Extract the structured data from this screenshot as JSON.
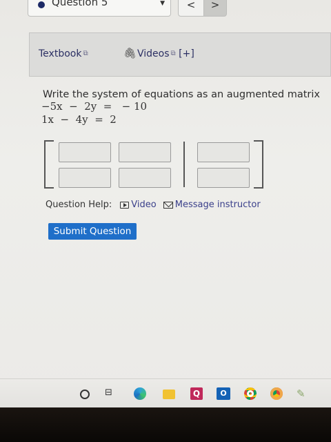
{
  "nav": {
    "question_label": "Question 5",
    "prev_symbol": "<",
    "next_symbol": ">"
  },
  "resources": {
    "textbook_label": "Textbook",
    "videos_label": "Videos",
    "expand_label": "[+]"
  },
  "question": {
    "prompt": "Write the system of equations as an augmented matrix",
    "equations": [
      "−5x  −  2y  =   − 10",
      "1x  −  4y  =  2"
    ],
    "matrix_inputs": [
      [
        "",
        "",
        ""
      ],
      [
        "",
        "",
        ""
      ]
    ]
  },
  "help": {
    "label": "Question Help:",
    "video_link": "Video",
    "message_link": "Message instructor"
  },
  "submit_label": "Submit Question",
  "taskbar": {
    "task_view_glyph": "⊟",
    "q_app_letter": "Q",
    "outlook_letter": "O",
    "pen_glyph": "✎"
  },
  "colors": {
    "submit_bg": "#1f6fc9",
    "link": "#3a3f8a"
  }
}
